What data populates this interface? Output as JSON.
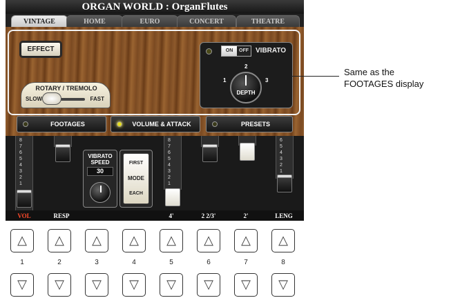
{
  "window": {
    "title": "ORGAN WORLD : OrganFlutes"
  },
  "tabs": [
    {
      "label": "VINTAGE",
      "active": true
    },
    {
      "label": "HOME",
      "active": false
    },
    {
      "label": "EURO",
      "active": false
    },
    {
      "label": "CONCERT",
      "active": false
    },
    {
      "label": "THEATRE",
      "active": false
    }
  ],
  "effect": {
    "label": "EFFECT"
  },
  "rotary": {
    "title": "ROTARY / TREMOLO",
    "slow": "SLOW",
    "fast": "FAST",
    "state": "SLOW"
  },
  "vibrato": {
    "label": "VIBRATO",
    "on_label": "ON",
    "off_label": "OFF",
    "state": "ON",
    "depth": {
      "label": "DEPTH",
      "ticks": [
        "1",
        "2",
        "3"
      ],
      "value": 2
    }
  },
  "selectors": [
    {
      "label": "FOOTAGES",
      "led": false
    },
    {
      "label": "VOLUME & ATTACK",
      "led": true
    },
    {
      "label": "PRESETS",
      "led": false
    }
  ],
  "drawbars": {
    "scale": [
      "8",
      "7",
      "6",
      "5",
      "4",
      "3",
      "2",
      "1"
    ],
    "scale_short": [
      "6",
      "5",
      "4",
      "3",
      "2",
      "1"
    ],
    "items": [
      {
        "label": "VOL",
        "value": 0
      },
      {
        "label": "RESP",
        "value": 8
      },
      {
        "label": "4'",
        "value": 0
      },
      {
        "label": "2 2/3'",
        "value": 8
      },
      {
        "label": "2'",
        "value": 8
      },
      {
        "label": "LENG",
        "value": 2
      }
    ]
  },
  "vibrato_speed": {
    "title_line1": "VIBRATO",
    "title_line2": "SPEED",
    "value": "30"
  },
  "mode_switch": {
    "first": "FIRST",
    "mode": "MODE",
    "each": "EACH",
    "state": "FIRST"
  },
  "panel_buttons": {
    "up_glyph": "△",
    "down_glyph": "▽",
    "numbers": [
      "1",
      "2",
      "3",
      "4",
      "5",
      "6",
      "7",
      "8"
    ]
  },
  "callout": {
    "line1": "Same as the",
    "line2": "FOOTAGES display"
  }
}
